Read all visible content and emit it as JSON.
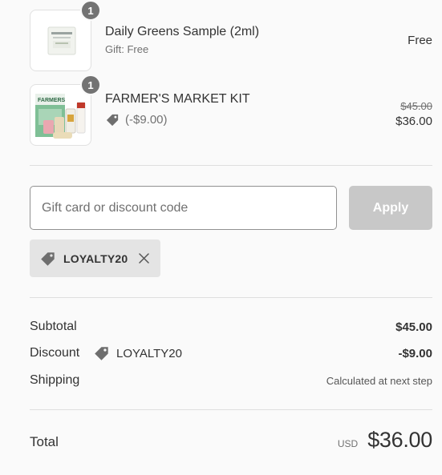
{
  "items": [
    {
      "quantity": "1",
      "title": "Daily Greens Sample (2ml)",
      "subtitle": "Gift: Free",
      "price": "Free"
    },
    {
      "quantity": "1",
      "title": "FARMER'S MARKET KIT",
      "discount": "(-$9.00)",
      "original_price": "$45.00",
      "price": "$36.00",
      "image_text": "FARMERS"
    }
  ],
  "discount_form": {
    "placeholder": "Gift card or discount code",
    "apply_label": "Apply",
    "applied_code": "LOYALTY20"
  },
  "summary": {
    "subtotal_label": "Subtotal",
    "subtotal_value": "$45.00",
    "discount_label": "Discount",
    "discount_code": "LOYALTY20",
    "discount_value": "-$9.00",
    "shipping_label": "Shipping",
    "shipping_value": "Calculated at next step",
    "total_label": "Total",
    "currency": "USD",
    "total_value": "$36.00"
  },
  "icons": {
    "tag": "tag-icon",
    "close": "close-icon"
  },
  "colors": {
    "background": "#fafafa",
    "badge": "#737373",
    "apply_disabled": "#c8c8c8",
    "chip": "#e4e4e4"
  }
}
